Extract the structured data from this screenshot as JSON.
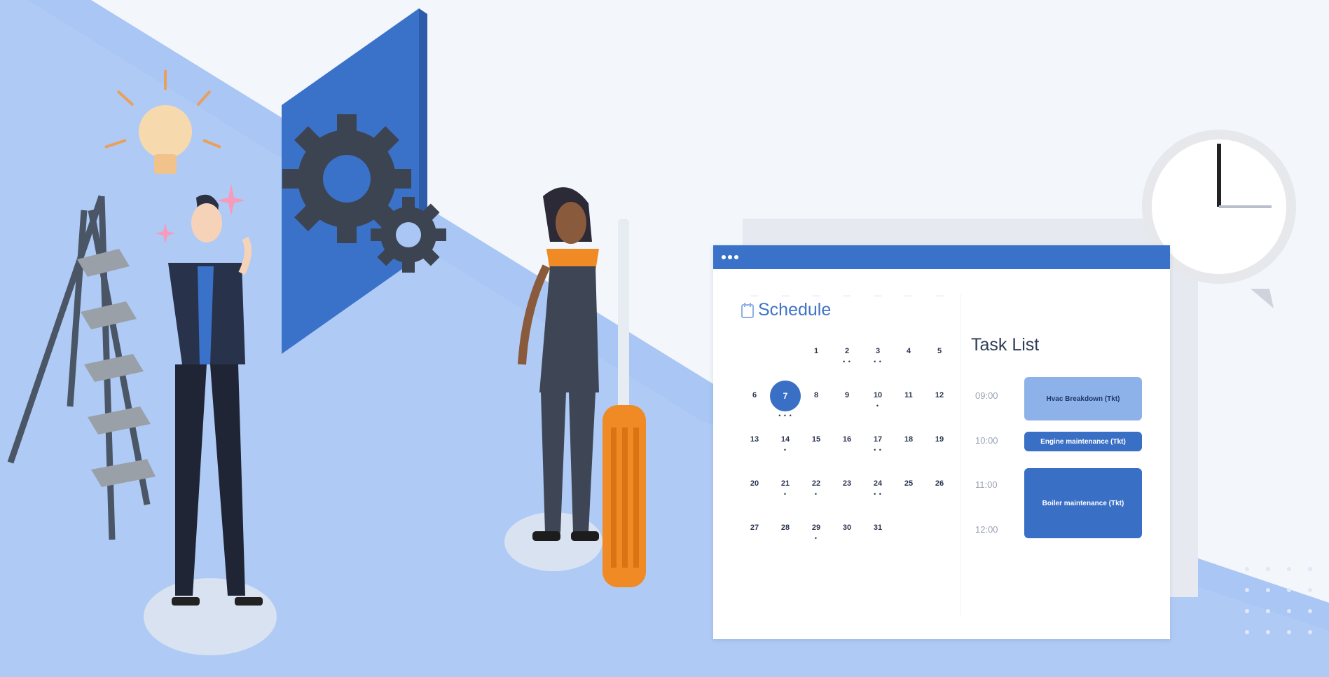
{
  "schedule": {
    "title": "Schedule"
  },
  "calendar": {
    "weekday_labels": [
      "—",
      "—",
      "—",
      "—",
      "—",
      "—",
      "—"
    ],
    "days": [
      "1",
      "2",
      "3",
      "4",
      "5",
      "6",
      "7",
      "8",
      "9",
      "10",
      "11",
      "12",
      "13",
      "14",
      "15",
      "16",
      "17",
      "18",
      "19",
      "20",
      "21",
      "22",
      "23",
      "24",
      "25",
      "26",
      "27",
      "28",
      "29",
      "30",
      "31"
    ],
    "selected_day": "7"
  },
  "task_list": {
    "title": "Task List",
    "times": [
      "09:00",
      "10:00",
      "11:00",
      "12:00"
    ],
    "tasks": [
      {
        "label": "Hvac Breakdown (Tkt)"
      },
      {
        "label": "Engine maintenance (Tkt)"
      },
      {
        "label": "Boiler maintenance (Tkt)"
      }
    ]
  },
  "colors": {
    "primary_blue": "#3b72c9",
    "light_blue": "#8db2ea",
    "background_blue": "#a9c6f4",
    "accent_orange": "#f08a24"
  },
  "icons": [
    "lightbulb-icon",
    "gear-icon",
    "calendar-icon",
    "clock-icon",
    "screwdriver-icon",
    "ladder-icon"
  ]
}
